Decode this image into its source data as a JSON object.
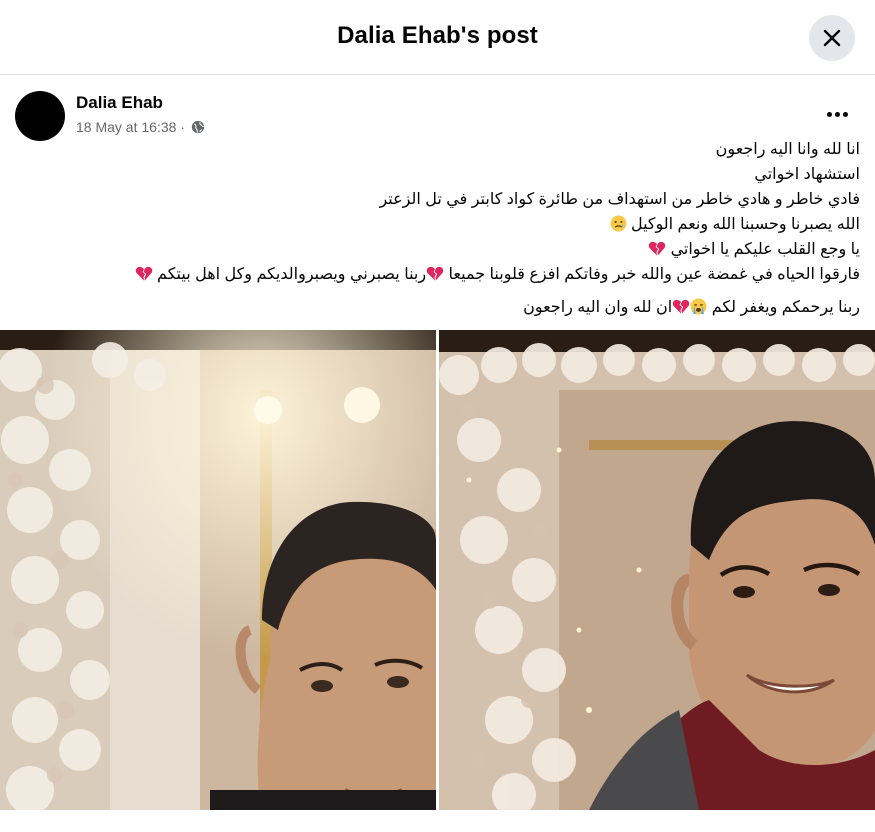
{
  "dialog": {
    "title": "Dalia Ehab's post",
    "close_icon": "close-icon"
  },
  "post": {
    "author": "Dalia Ehab",
    "timestamp": "18 May at 16:38",
    "separator": "·",
    "privacy_icon": "globe-icon",
    "more_icon": "more-options-icon",
    "lines": [
      "انا لله وانا اليه راجعون",
      "استشهاد اخواتي",
      "فادي خاطر  و هادي خاطر من استهداف من طائرة كواد كابتر في تل الزعتر",
      "الله يصبرنا  وحسبنا الله ونعم الوكيل",
      "يا وجع القلب عليكم يا اخواتي",
      "فارقوا الحياه في غمضة عين والله خبر وفاتكم افزع قلوبنا جميعا",
      "ربنا يصبرني ويصبروالديكم وكل اهل بيتكم",
      "ربنا يرحمكم ويغفر لكم",
      "ان لله وان اليه راجعون"
    ],
    "photos": [
      {
        "name": "photo-1"
      },
      {
        "name": "photo-2"
      }
    ]
  },
  "colors": {
    "text": "#050505",
    "meta": "#65676b",
    "close_bg": "#e4e6eb",
    "divider": "#dadde1",
    "heart_red": "#e0245e"
  }
}
